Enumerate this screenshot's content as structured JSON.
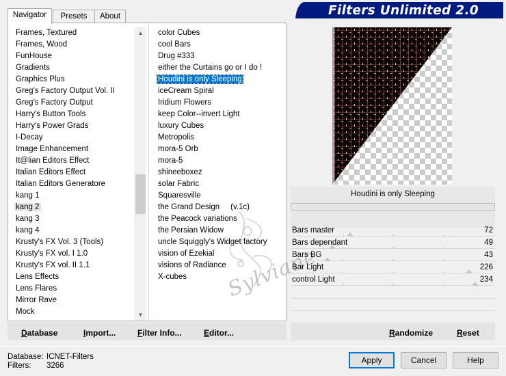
{
  "tabs": [
    {
      "label": "Navigator",
      "active": true
    },
    {
      "label": "Presets",
      "active": false
    },
    {
      "label": "About",
      "active": false
    }
  ],
  "banner": {
    "title": "Filters Unlimited 2.0",
    "color": "#001a80"
  },
  "categories": {
    "items": [
      "Frames, Textured",
      "Frames, Wood",
      "FunHouse",
      "Gradients",
      "Graphics Plus",
      "Greg's Factory Output Vol. II",
      "Greg's Factory Output",
      "Harry's Button Tools",
      "Harry's Power Grads",
      "I-Decay",
      "Image Enhancement",
      "It@lian Editors Effect",
      "Italian Editors Effect",
      "Italian Editors Generatore",
      "kang 1",
      "kang 2",
      "kang 3",
      "kang 4",
      "Krusty's FX Vol. 3 (Tools)",
      "Krusty's FX vol. I 1.0",
      "Krusty's FX vol. II 1.1",
      "Lens Effects",
      "Lens Flares",
      "Mirror Rave",
      "Mock"
    ],
    "selected": "kang 2"
  },
  "filters": {
    "items": [
      "color Cubes",
      "cool Bars",
      "Drug #333",
      "either the Curtains go or I do !",
      "Houdini is only Sleeping",
      "iceCream Spiral",
      "Iridium Flowers",
      "keep Color--invert Light",
      "luxury Cubes",
      "Metropolis",
      "mora-5 Orb",
      "mora-5",
      "shineeboxez",
      "solar Fabric",
      "Squaresville",
      "the Grand Design     (v.1c)",
      "the Peacock variations",
      "the Persian Widow",
      "uncle Squiggly's Widget factory",
      "vision of Ezekial",
      "visions of Radiance",
      "X-cubes"
    ],
    "selected": "Houdini is only Sleeping"
  },
  "watermark": "Sylviane",
  "preview": {
    "filter_name": "Houdini is only Sleeping"
  },
  "sliders": [
    {
      "label": "Bars master",
      "value": "72",
      "max": 255
    },
    {
      "label": "Bars dependant",
      "value": "49",
      "max": 255
    },
    {
      "label": "Bars BG",
      "value": "43",
      "max": 255
    },
    {
      "label": "Bar Light",
      "value": "226",
      "max": 255
    },
    {
      "label": "control Light",
      "value": "234",
      "max": 255
    }
  ],
  "left_buttons": {
    "database": "Database",
    "import": "Import...",
    "filter_info": "Filter Info...",
    "editor": "Editor..."
  },
  "right_buttons": {
    "randomize": "Randomize",
    "reset": "Reset"
  },
  "status": {
    "database_label": "Database:",
    "database_value": "ICNET-Filters",
    "filters_label": "Filters:",
    "filters_value": "3266"
  },
  "dialog_buttons": {
    "apply": "Apply",
    "cancel": "Cancel",
    "help": "Help"
  }
}
